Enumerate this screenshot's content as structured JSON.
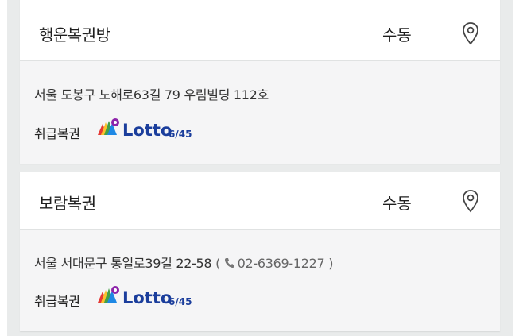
{
  "stores": [
    {
      "name": "행운복권방",
      "method": "수동",
      "address": "서울 도봉구 노해로63길 79 우림빌딩 112호",
      "phone": "",
      "tag_label": "취급복권",
      "lottery_brand": "Lotto",
      "lottery_suffix": "6/45"
    },
    {
      "name": "보람복권",
      "method": "수동",
      "address": "서울 서대문구 통일로39길 22-58",
      "phone_open": "(",
      "phone": "02-6369-1227",
      "phone_close": ")",
      "tag_label": "취급복권",
      "lottery_brand": "Lotto",
      "lottery_suffix": "6/45"
    }
  ],
  "icons": {
    "map": "map-pin-icon",
    "phone": "phone-icon",
    "lotto_logo": "lotto-logo-icon"
  },
  "colors": {
    "panel_bg": "#e9ebeb",
    "card_header_bg": "#ffffff",
    "card_body_bg": "#f5f5f6",
    "lotto_blue": "#1b3e9c",
    "lotto_green": "#7cb342"
  }
}
